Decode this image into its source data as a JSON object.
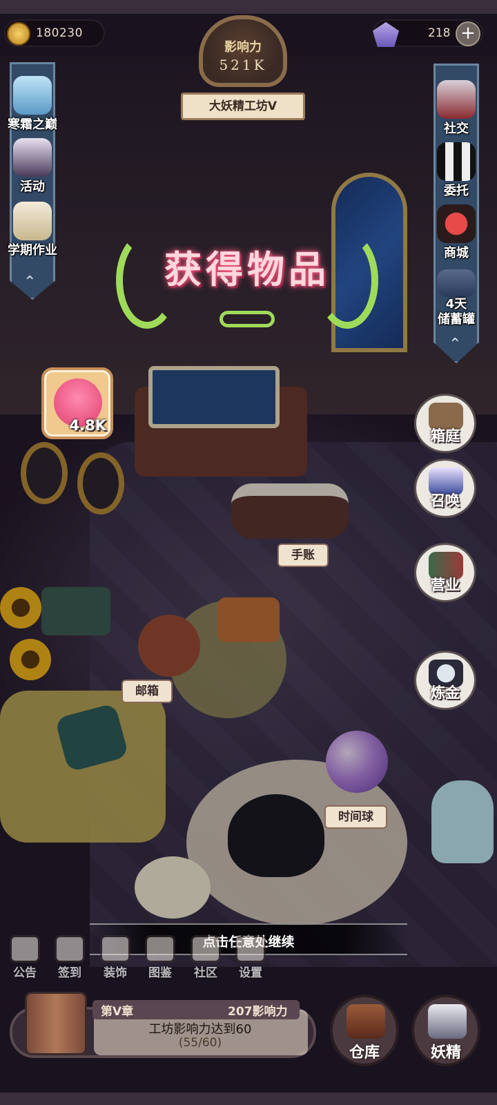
{
  "top_bar": {
    "coins": "180230",
    "gems": "218",
    "plus_label": "+"
  },
  "influence": {
    "label": "影响力",
    "value": "521K",
    "level_title": "大妖精工坊V"
  },
  "left_menu": [
    {
      "label": "寒霜之巅",
      "icon": "frost-peak-icon"
    },
    {
      "label": "活动",
      "icon": "event-icon"
    },
    {
      "label": "学期作业",
      "icon": "homework-icon"
    }
  ],
  "right_menu": [
    {
      "label": "社交",
      "icon": "social-icon"
    },
    {
      "label": "委托",
      "icon": "commission-icon"
    },
    {
      "label": "商城",
      "icon": "shop-icon"
    },
    {
      "label": "4天\n储蓄罐",
      "icon": "piggy-bank-icon"
    }
  ],
  "bubbles": [
    {
      "label": "箱庭",
      "icon": "garden-box-icon"
    },
    {
      "label": "召唤",
      "icon": "summon-icon"
    },
    {
      "label": "营业",
      "icon": "business-icon"
    },
    {
      "label": "炼金",
      "icon": "alchemy-icon"
    }
  ],
  "scene_labels": {
    "notebook": "手账",
    "mailbox": "邮箱",
    "time_orb": "时间球"
  },
  "reward": {
    "title": "获得物品",
    "item_amount": "4.8K",
    "item_icon": "influence-token-icon"
  },
  "continue_hint": "点击任意处继续",
  "bottom_menu": [
    {
      "label": "公告",
      "icon": "notice-icon"
    },
    {
      "label": "签到",
      "icon": "checkin-icon"
    },
    {
      "label": "装饰",
      "icon": "decor-icon"
    },
    {
      "label": "图鉴",
      "icon": "collection-icon"
    },
    {
      "label": "社区",
      "icon": "community-icon"
    },
    {
      "label": "设置",
      "icon": "settings-icon"
    }
  ],
  "quest": {
    "chapter": "第V章",
    "reward": "207影响力",
    "title": "工坊影响力达到60",
    "progress": "(55/60)"
  },
  "big_buttons": [
    {
      "label": "仓库",
      "icon": "warehouse-icon"
    },
    {
      "label": "妖精",
      "icon": "fairy-icon"
    }
  ],
  "colors": {
    "reward_glow": "#ff6a8a",
    "laurel": "#9fdb5a",
    "banner_blue": "#334a66"
  }
}
